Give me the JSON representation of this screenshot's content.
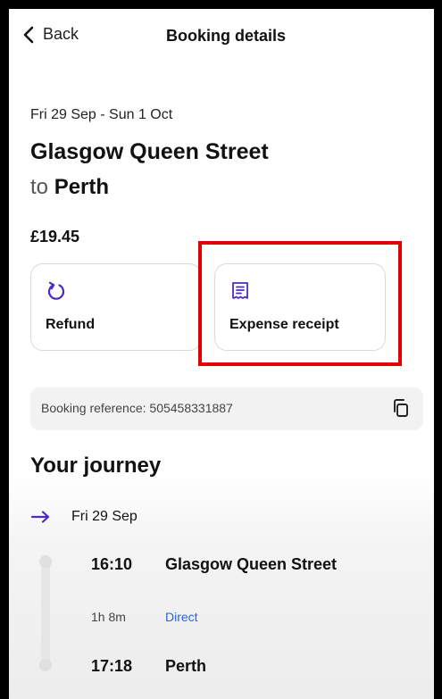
{
  "header": {
    "back_label": "Back",
    "title": "Booking details"
  },
  "trip": {
    "dates": "Fri 29 Sep - Sun 1 Oct",
    "origin": "Glasgow Queen Street",
    "to_word": "to",
    "destination": "Perth",
    "price": "£19.45"
  },
  "actions": [
    {
      "label": "Refund",
      "icon": "refund-icon"
    },
    {
      "label": "Expense receipt",
      "icon": "receipt-icon"
    }
  ],
  "booking": {
    "reference_text": "Booking reference: 505458331887"
  },
  "journey": {
    "heading": "Your journey",
    "leg_date": "Fri 29 Sep",
    "depart_time": "16:10",
    "depart_station": "Glasgow Queen Street",
    "duration": "1h 8m",
    "service": "Direct",
    "arrive_time": "17:18",
    "arrive_station": "Perth"
  },
  "colors": {
    "accent": "#4b2bbf",
    "link": "#2a63d8",
    "highlight": "#e00000"
  }
}
